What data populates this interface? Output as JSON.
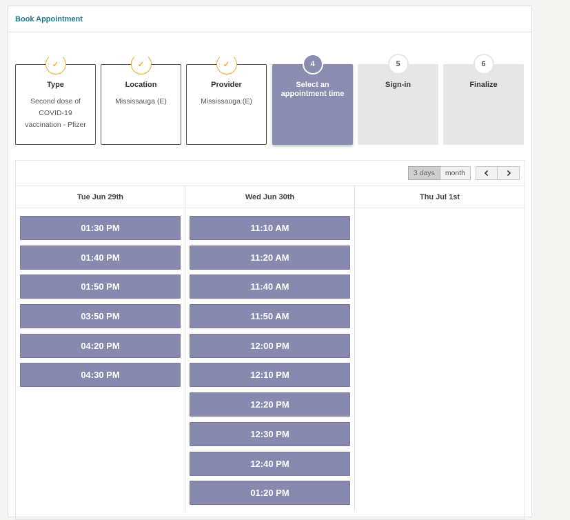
{
  "panel": {
    "title": "Book Appointment"
  },
  "steps": [
    {
      "title": "Type",
      "desc": "Second dose of COVID-19 vaccination - Pfizer",
      "badge": "✓"
    },
    {
      "title": "Location",
      "desc": "Mississauga (E)",
      "badge": "✓"
    },
    {
      "title": "Provider",
      "desc": "Mississauga (E)",
      "badge": "✓"
    },
    {
      "title": "Select an appointment time",
      "desc": "",
      "badge": "4"
    },
    {
      "title": "Sign-in",
      "desc": "",
      "badge": "5"
    },
    {
      "title": "Finalize",
      "desc": "",
      "badge": "6"
    }
  ],
  "toolbar": {
    "view_3days": "3 days",
    "view_month": "month",
    "prev_icon": "‹",
    "next_icon": "›"
  },
  "days": [
    {
      "label": "Tue Jun 29th",
      "slots": [
        "01:30 PM",
        "01:40 PM",
        "01:50 PM",
        "03:50 PM",
        "04:20 PM",
        "04:30 PM"
      ]
    },
    {
      "label": "Wed Jun 30th",
      "slots": [
        "11:10 AM",
        "11:20 AM",
        "11:40 AM",
        "11:50 AM",
        "12:00 PM",
        "12:10 PM",
        "12:20 PM",
        "12:30 PM",
        "12:40 PM",
        "01:20 PM"
      ]
    },
    {
      "label": "Thu Jul 1st",
      "slots": []
    }
  ],
  "colors": {
    "accent": "#8a8cb0",
    "check": "#f0a818",
    "title": "#1a7a8c"
  }
}
